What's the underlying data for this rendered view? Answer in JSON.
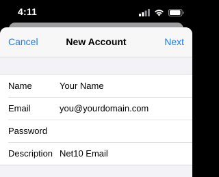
{
  "status_bar": {
    "time": "4:11",
    "icons": [
      "cellular-signal-icon",
      "wifi-icon",
      "battery-icon"
    ]
  },
  "nav": {
    "cancel_label": "Cancel",
    "title": "New Account",
    "next_label": "Next"
  },
  "form": {
    "rows": [
      {
        "label": "Name",
        "value": "Your Name"
      },
      {
        "label": "Email",
        "value": "you@yourdomain.com"
      },
      {
        "label": "Password",
        "value": ""
      },
      {
        "label": "Description",
        "value": "Net10 Email"
      }
    ]
  },
  "colors": {
    "accent": "#1a7cf4",
    "background": "#f2f2f7"
  }
}
